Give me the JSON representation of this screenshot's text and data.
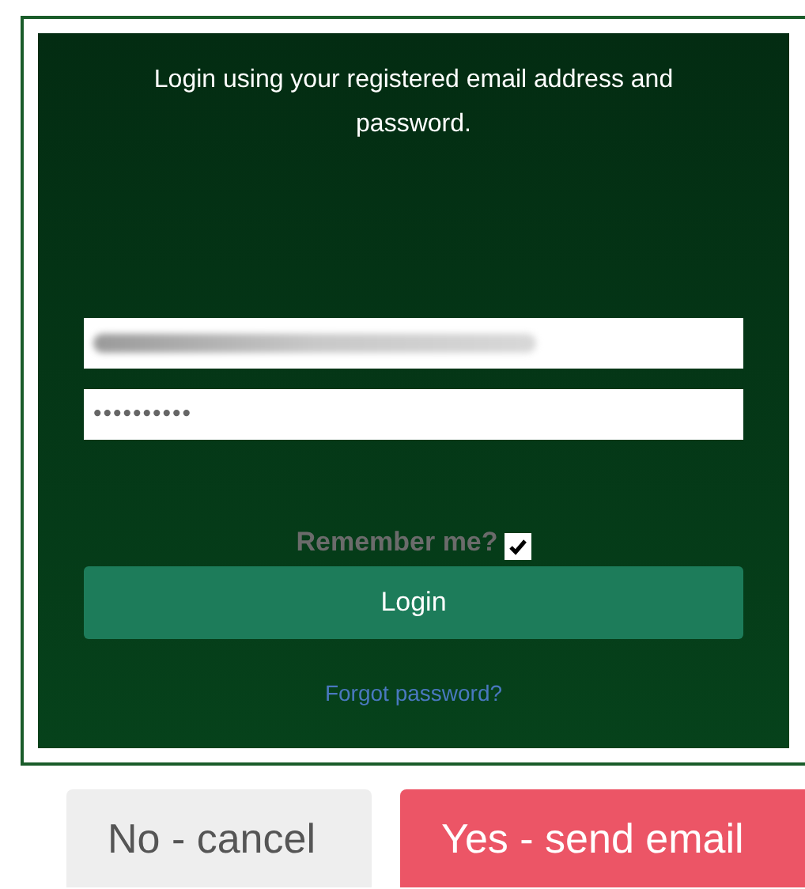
{
  "login_panel": {
    "message": "Login using your registered email address and password.",
    "password_field": {
      "value": "••••••••••"
    },
    "remember_me": {
      "label": "Remember me?",
      "checked": true
    },
    "login_button": "Login",
    "forgot_password_link": "Forgot password?"
  },
  "buttons": [
    {
      "label": "No - cancel",
      "kind": "secondary"
    },
    {
      "label": "Yes - send email",
      "kind": "danger"
    }
  ]
}
